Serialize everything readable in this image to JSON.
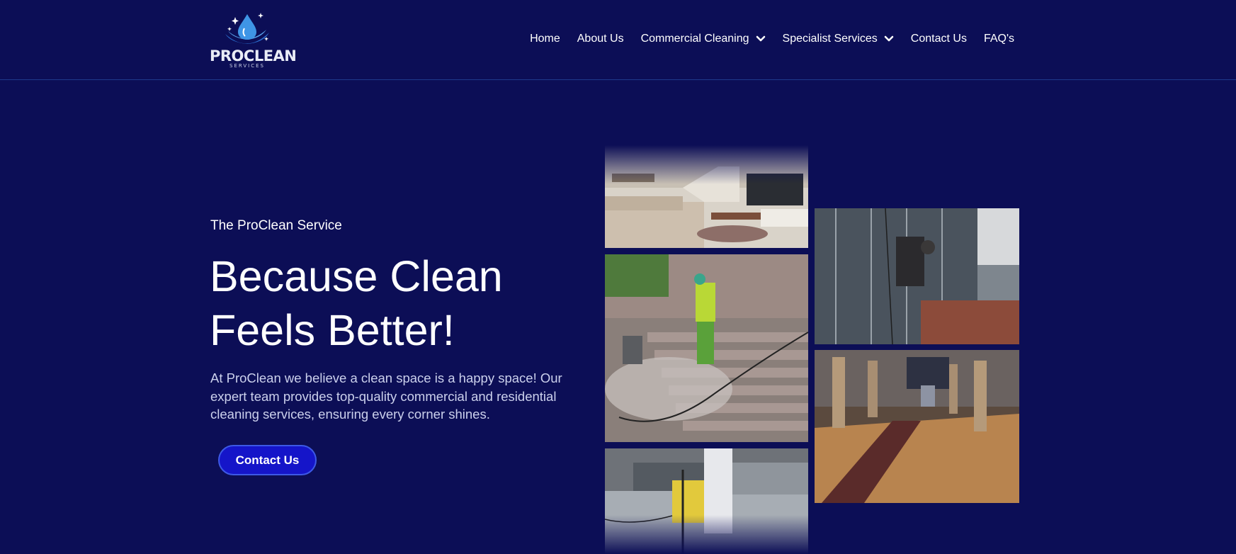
{
  "brand": {
    "name": "PROCLEAN",
    "tagline": "SERVICES",
    "colors": {
      "background": "#0c0e56",
      "accent": "#1515c9",
      "logo_blue": "#3a8fe0"
    }
  },
  "nav": {
    "items": [
      {
        "label": "Home",
        "has_dropdown": false
      },
      {
        "label": "About Us",
        "has_dropdown": false
      },
      {
        "label": "Commercial Cleaning",
        "has_dropdown": true
      },
      {
        "label": "Specialist Services",
        "has_dropdown": true
      },
      {
        "label": "Contact Us",
        "has_dropdown": false
      },
      {
        "label": "FAQ's",
        "has_dropdown": false
      }
    ]
  },
  "hero": {
    "eyebrow": "The ProClean Service",
    "headline_line1": "Because Clean",
    "headline_line2": "Feels Better!",
    "description": "At ProClean we believe a clean space is a happy space! Our expert team provides top-quality commercial and residential cleaning services, ensuring every corner shines.",
    "cta_label": "Contact Us"
  },
  "gallery": {
    "icons": [
      "living-room-photo",
      "pressure-washing-photo",
      "vacuum-cleaning-photo",
      "window-cleaning-photo",
      "church-floor-photo"
    ]
  }
}
